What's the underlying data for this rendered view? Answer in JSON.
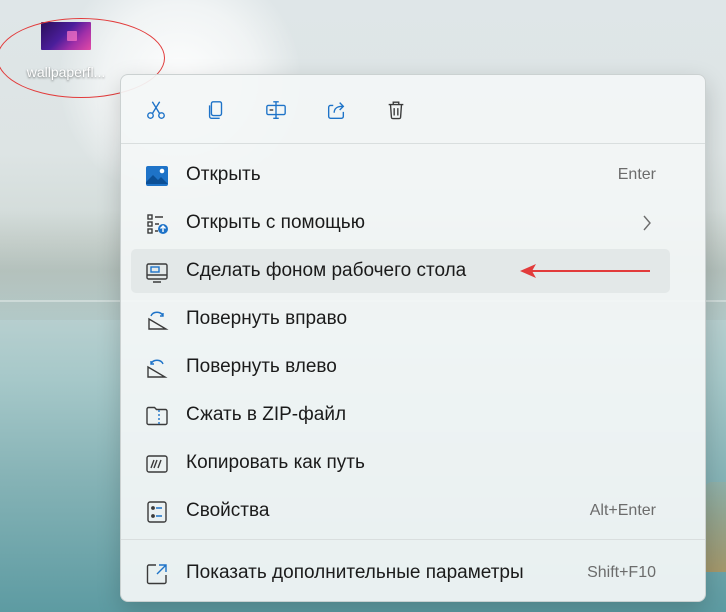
{
  "desktop": {
    "file_label": "wallpaperfl..."
  },
  "menu": {
    "toolbar": [
      {
        "name": "cut-icon"
      },
      {
        "name": "copy-icon"
      },
      {
        "name": "rename-icon"
      },
      {
        "name": "share-icon"
      },
      {
        "name": "delete-icon"
      }
    ],
    "items": [
      {
        "label": "Открыть",
        "shortcut": "Enter",
        "icon": "image-icon"
      },
      {
        "label": "Открыть с помощью",
        "shortcut": "",
        "icon": "open-with-icon"
      },
      {
        "label": "Сделать фоном рабочего стола",
        "shortcut": "",
        "icon": "set-wallpaper-icon"
      },
      {
        "label": "Повернуть вправо",
        "shortcut": "",
        "icon": "rotate-right-icon"
      },
      {
        "label": "Повернуть влево",
        "shortcut": "",
        "icon": "rotate-left-icon"
      },
      {
        "label": "Сжать в ZIP-файл",
        "shortcut": "",
        "icon": "zip-icon"
      },
      {
        "label": "Копировать как путь",
        "shortcut": "",
        "icon": "copy-path-icon"
      },
      {
        "label": "Свойства",
        "shortcut": "Alt+Enter",
        "icon": "properties-icon"
      },
      {
        "label": "Показать дополнительные параметры",
        "shortcut": "Shift+F10",
        "icon": "more-options-icon"
      }
    ]
  },
  "colors": {
    "annotation": "#e23b3b",
    "icon_blue": "#1e73c8",
    "icon_dark": "#3a3a3a"
  }
}
